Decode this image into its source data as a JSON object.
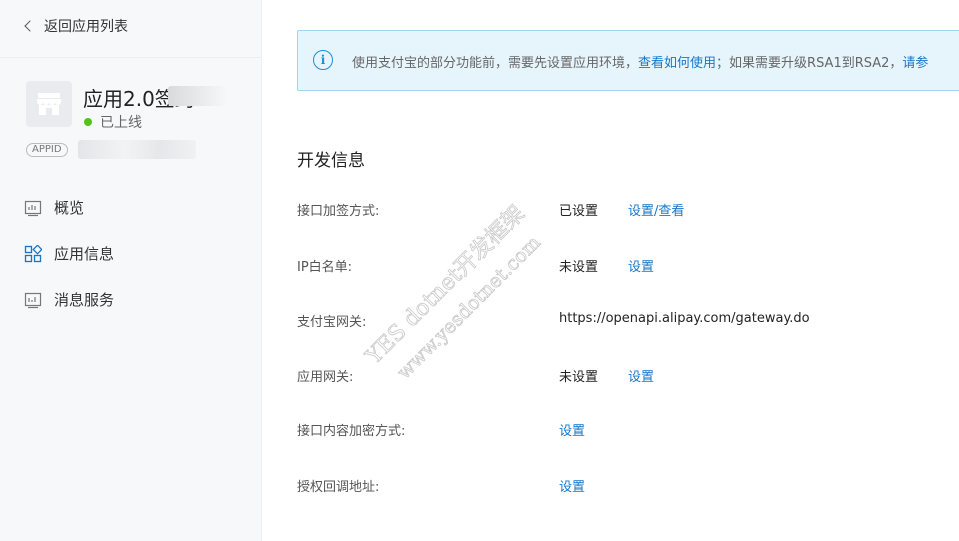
{
  "sidebar": {
    "back_label": "返回应用列表",
    "app_name": "应用2.0签约",
    "app_status": "已上线",
    "appid_tag": "APPID",
    "nav": [
      {
        "label": "概览",
        "icon": "chart-icon"
      },
      {
        "label": "应用信息",
        "icon": "grid-icon"
      },
      {
        "label": "消息服务",
        "icon": "message-chart-icon"
      }
    ]
  },
  "notice": {
    "text_prefix": "使用支付宝的部分功能前，需要先设置应用环境，",
    "link1": "查看如何使用",
    "text_middle": "；如果需要升级RSA1到RSA2，",
    "link2": "请参"
  },
  "dev_info": {
    "title": "开发信息",
    "rows": [
      {
        "label": "接口加签方式:",
        "value": "已设置",
        "link": "设置/查看"
      },
      {
        "label": "IP白名单:",
        "value": "未设置",
        "link": "设置"
      },
      {
        "label": "支付宝网关:",
        "value": "https://openapi.alipay.com/gateway.do",
        "link": ""
      },
      {
        "label": "应用网关:",
        "value": "未设置",
        "link": "设置"
      },
      {
        "label": "接口内容加密方式:",
        "value": "",
        "link": "设置"
      },
      {
        "label": "授权回调地址:",
        "value": "",
        "link": "设置"
      }
    ]
  },
  "watermark": {
    "line1": "YES dotnet开发框架",
    "line2": "www.yesdotnet.com"
  },
  "colors": {
    "accent": "#1677c9",
    "online": "#52c41a",
    "notice_bg": "#e6f4fc"
  }
}
